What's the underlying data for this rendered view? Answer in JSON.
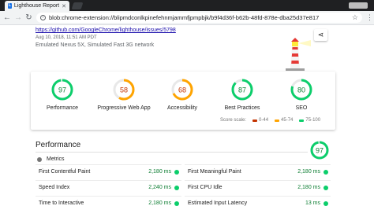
{
  "browser": {
    "tab_title": "Lighthouse Report",
    "tab_favicon": "lighthouse-icon",
    "profile_label": "[profile badge]",
    "url": "blob:chrome-extension://blipmdconlkpinefehnmjammfjpmpbjk/b9f4d36f-b62b-48fd-878e-dba25d37e817"
  },
  "report": {
    "url": "https://github.com/GoogleChrome/lighthouse/issues/5798",
    "date": "Aug 10, 2018, 11:51 AM PDT",
    "device": "Emulated Nexus 5X, Simulated Fast 3G network",
    "share_icon": "share-icon"
  },
  "categories": [
    {
      "label": "Performance",
      "score": "97",
      "value": 97,
      "color": "#0cce6b",
      "text_color": "#0c7d32"
    },
    {
      "label": "Progressive Web App",
      "score": "58",
      "value": 58,
      "color": "#ffa400",
      "text_color": "#c33300"
    },
    {
      "label": "Accessibility",
      "score": "68",
      "value": 68,
      "color": "#ffa400",
      "text_color": "#c33300"
    },
    {
      "label": "Best Practices",
      "score": "87",
      "value": 87,
      "color": "#0cce6b",
      "text_color": "#0c7d32"
    },
    {
      "label": "SEO",
      "score": "80",
      "value": 80,
      "color": "#0cce6b",
      "text_color": "#0c7d32"
    }
  ],
  "legend": {
    "label": "Score scale:",
    "items": [
      {
        "range": "0-44",
        "color": "#c33300"
      },
      {
        "range": "45-74",
        "color": "#ffa400"
      },
      {
        "range": "75-100",
        "color": "#0cce6b"
      }
    ]
  },
  "performance": {
    "title": "Performance",
    "score": "97",
    "value": 97,
    "color": "#0cce6b",
    "metrics_label": "Metrics",
    "metrics": [
      {
        "name": "First Contentful Paint",
        "value": "2,180 ms"
      },
      {
        "name": "First Meaningful Paint",
        "value": "2,180 ms"
      },
      {
        "name": "Speed Index",
        "value": "2,240 ms"
      },
      {
        "name": "First CPU Idle",
        "value": "2,180 ms"
      },
      {
        "name": "Time to Interactive",
        "value": "2,180 ms"
      },
      {
        "name": "Estimated Input Latency",
        "value": "13 ms"
      }
    ]
  }
}
